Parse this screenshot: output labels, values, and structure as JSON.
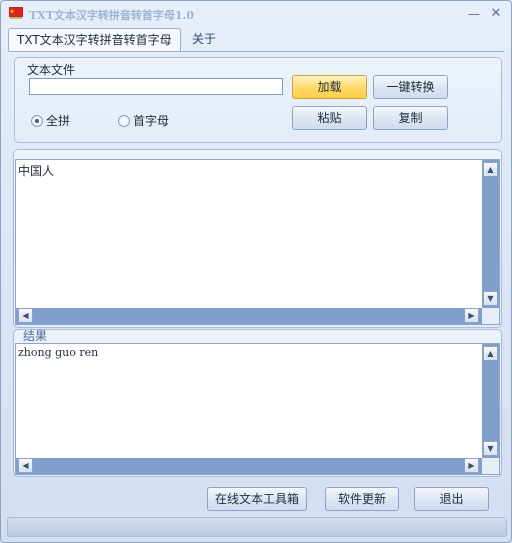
{
  "window": {
    "title": "TXT文本汉字转拼音转首字母1.0"
  },
  "tabs": [
    {
      "label": "TXT文本汉字转拼音转首字母",
      "active": true
    },
    {
      "label": "关于",
      "active": false
    }
  ],
  "file_group": {
    "legend": "文本文件",
    "path_value": "",
    "load_label": "加载",
    "convert_label": "一键转换",
    "paste_label": "粘贴",
    "copy_label": "复制",
    "radio_full": "全拼",
    "radio_first": "首字母",
    "selected": "全拼"
  },
  "source": {
    "text": "中国人"
  },
  "result": {
    "legend": "结果",
    "text": "zhong guo ren"
  },
  "footer": {
    "tools_label": "在线文本工具箱",
    "update_label": "软件更新",
    "exit_label": "退出"
  },
  "icons": {
    "app": "china-flag-icon",
    "minimize": "minimize-icon",
    "close": "close-icon"
  },
  "colors": {
    "accent_button": "#ffd86a",
    "scrollbar": "#7f9fcc"
  }
}
